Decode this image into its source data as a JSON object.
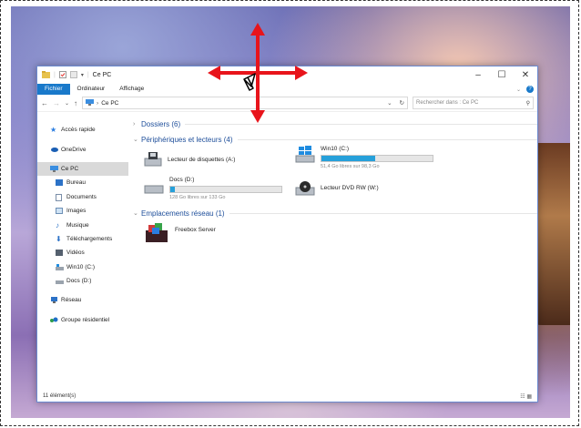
{
  "window": {
    "title": "Ce PC"
  },
  "ribbon": {
    "tabs": [
      "Fichier",
      "Ordinateur",
      "Affichage"
    ]
  },
  "address": {
    "path": "Ce PC",
    "search_placeholder": "Rechercher dans : Ce PC"
  },
  "nav": {
    "quick_access": "Accès rapide",
    "onedrive": "OneDrive",
    "this_pc": "Ce PC",
    "children": [
      "Bureau",
      "Documents",
      "Images",
      "Musique",
      "Téléchargements",
      "Vidéos",
      "Win10 (C:)",
      "Docs (D:)"
    ],
    "network": "Réseau",
    "homegroup": "Groupe résidentiel"
  },
  "sections": {
    "folders": "Dossiers (6)",
    "devices": "Périphériques et lecteurs (4)",
    "network": "Emplacements réseau (1)"
  },
  "drives": {
    "floppy": {
      "name": "Lecteur de disquettes (A:)"
    },
    "c": {
      "name": "Win10 (C:)",
      "free": "51,4 Go libres sur 98,3 Go",
      "used_fraction": 0.48
    },
    "d": {
      "name": "Docs (D:)",
      "free": "128 Go libres sur 133 Go",
      "used_fraction": 0.04
    },
    "dvd": {
      "name": "Lecteur DVD RW (W:)"
    }
  },
  "network_items": [
    {
      "name": "Freebox Server"
    }
  ],
  "status": {
    "count": "11 élément(s)"
  },
  "colors": {
    "accent": "#1979ca",
    "bar_fill": "#26a0da",
    "move_cursor": "#e8141b"
  }
}
